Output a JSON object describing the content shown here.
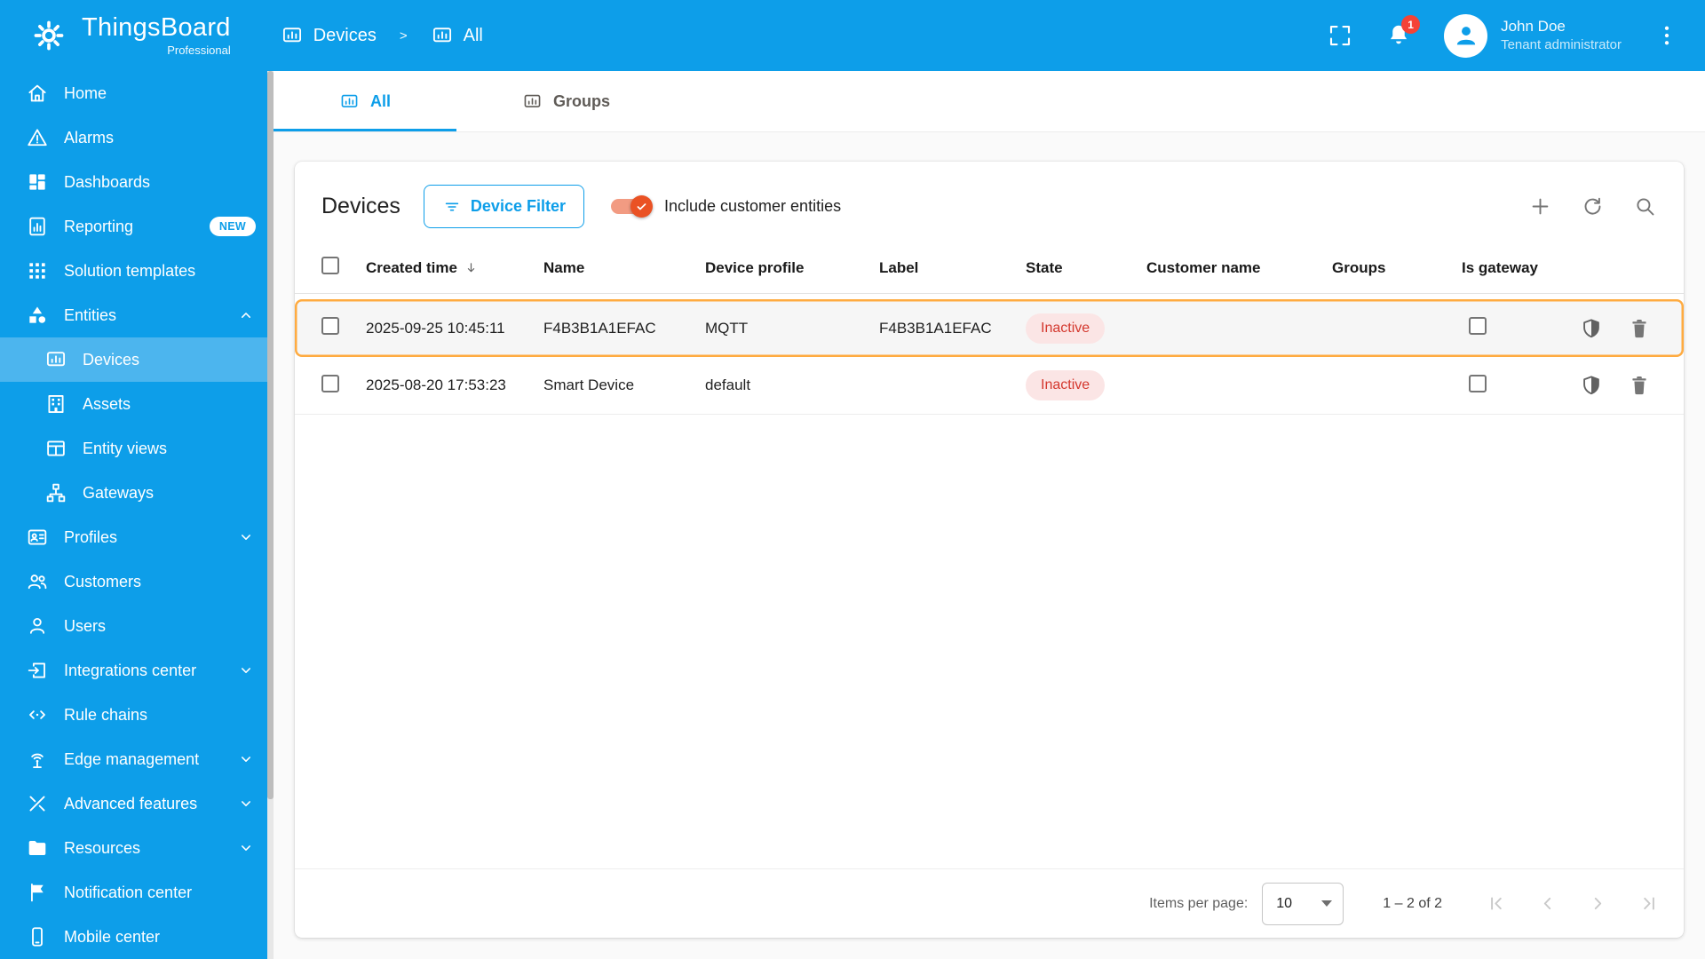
{
  "colors": {
    "primary": "#0d9ee9",
    "selected_row_border": "#ffab40",
    "inactive_chip_text": "#d4382e",
    "toggle_checked": "#ea5224",
    "notification_badge": "#f44336"
  },
  "header": {
    "brand": "ThingsBoard",
    "brand_sub": "Professional",
    "breadcrumb": {
      "section": "Devices",
      "separator": ">",
      "page": "All"
    },
    "notifications_badge": "1",
    "user_name": "John Doe",
    "user_role": "Tenant administrator",
    "icons": [
      "gear-logo",
      "fullscreen",
      "notifications-bell",
      "avatar-person",
      "more-vert"
    ]
  },
  "sidebar": {
    "items": [
      {
        "label": "Home",
        "icon": "home"
      },
      {
        "label": "Alarms",
        "icon": "warning"
      },
      {
        "label": "Dashboards",
        "icon": "dashboards"
      },
      {
        "label": "Reporting",
        "icon": "reporting",
        "badge": "NEW"
      },
      {
        "label": "Solution templates",
        "icon": "apps"
      },
      {
        "label": "Entities",
        "icon": "category",
        "expanded": true
      },
      {
        "label": "Devices",
        "icon": "devices",
        "active": true,
        "sub": true
      },
      {
        "label": "Assets",
        "icon": "assets",
        "sub": true
      },
      {
        "label": "Entity views",
        "icon": "entity-views",
        "sub": true
      },
      {
        "label": "Gateways",
        "icon": "gateways",
        "sub": true
      },
      {
        "label": "Profiles",
        "icon": "profiles",
        "collapsed": true
      },
      {
        "label": "Customers",
        "icon": "customers"
      },
      {
        "label": "Users",
        "icon": "users"
      },
      {
        "label": "Integrations center",
        "icon": "integrations",
        "collapsed": true
      },
      {
        "label": "Rule chains",
        "icon": "rule-chains"
      },
      {
        "label": "Edge management",
        "icon": "edge",
        "collapsed": true
      },
      {
        "label": "Advanced features",
        "icon": "tools",
        "collapsed": true
      },
      {
        "label": "Resources",
        "icon": "folder",
        "collapsed": true
      },
      {
        "label": "Notification center",
        "icon": "flag"
      },
      {
        "label": "Mobile center",
        "icon": "mobile"
      }
    ]
  },
  "tabs": {
    "all": "All",
    "groups": "Groups"
  },
  "devices": {
    "title": "Devices",
    "filter_button": "Device Filter",
    "include_toggle_label": "Include customer entities",
    "include_toggle_checked": true,
    "columns": [
      "Created time",
      "Name",
      "Device profile",
      "Label",
      "State",
      "Customer name",
      "Groups",
      "Is gateway"
    ],
    "sorted_by": "Created time",
    "sort_direction": "desc",
    "rows": [
      {
        "created": "2025-09-25 10:45:11",
        "name": "F4B3B1A1EFAC",
        "profile": "MQTT",
        "label": "F4B3B1A1EFAC",
        "state": "Inactive",
        "customer": "",
        "groups": "",
        "is_gateway": false,
        "selected_highlight": true
      },
      {
        "created": "2025-08-20 17:53:23",
        "name": "Smart Device",
        "profile": "default",
        "label": "",
        "state": "Inactive",
        "customer": "",
        "groups": "",
        "is_gateway": false,
        "selected_highlight": false
      }
    ],
    "toolbar_icons": [
      "add",
      "refresh",
      "search"
    ],
    "row_action_icons": [
      "shield",
      "trash"
    ]
  },
  "pagination": {
    "items_per_page_label": "Items per page:",
    "items_per_page": "10",
    "range": "1 – 2 of 2",
    "controls": [
      "first-page",
      "previous-page",
      "next-page",
      "last-page"
    ]
  }
}
